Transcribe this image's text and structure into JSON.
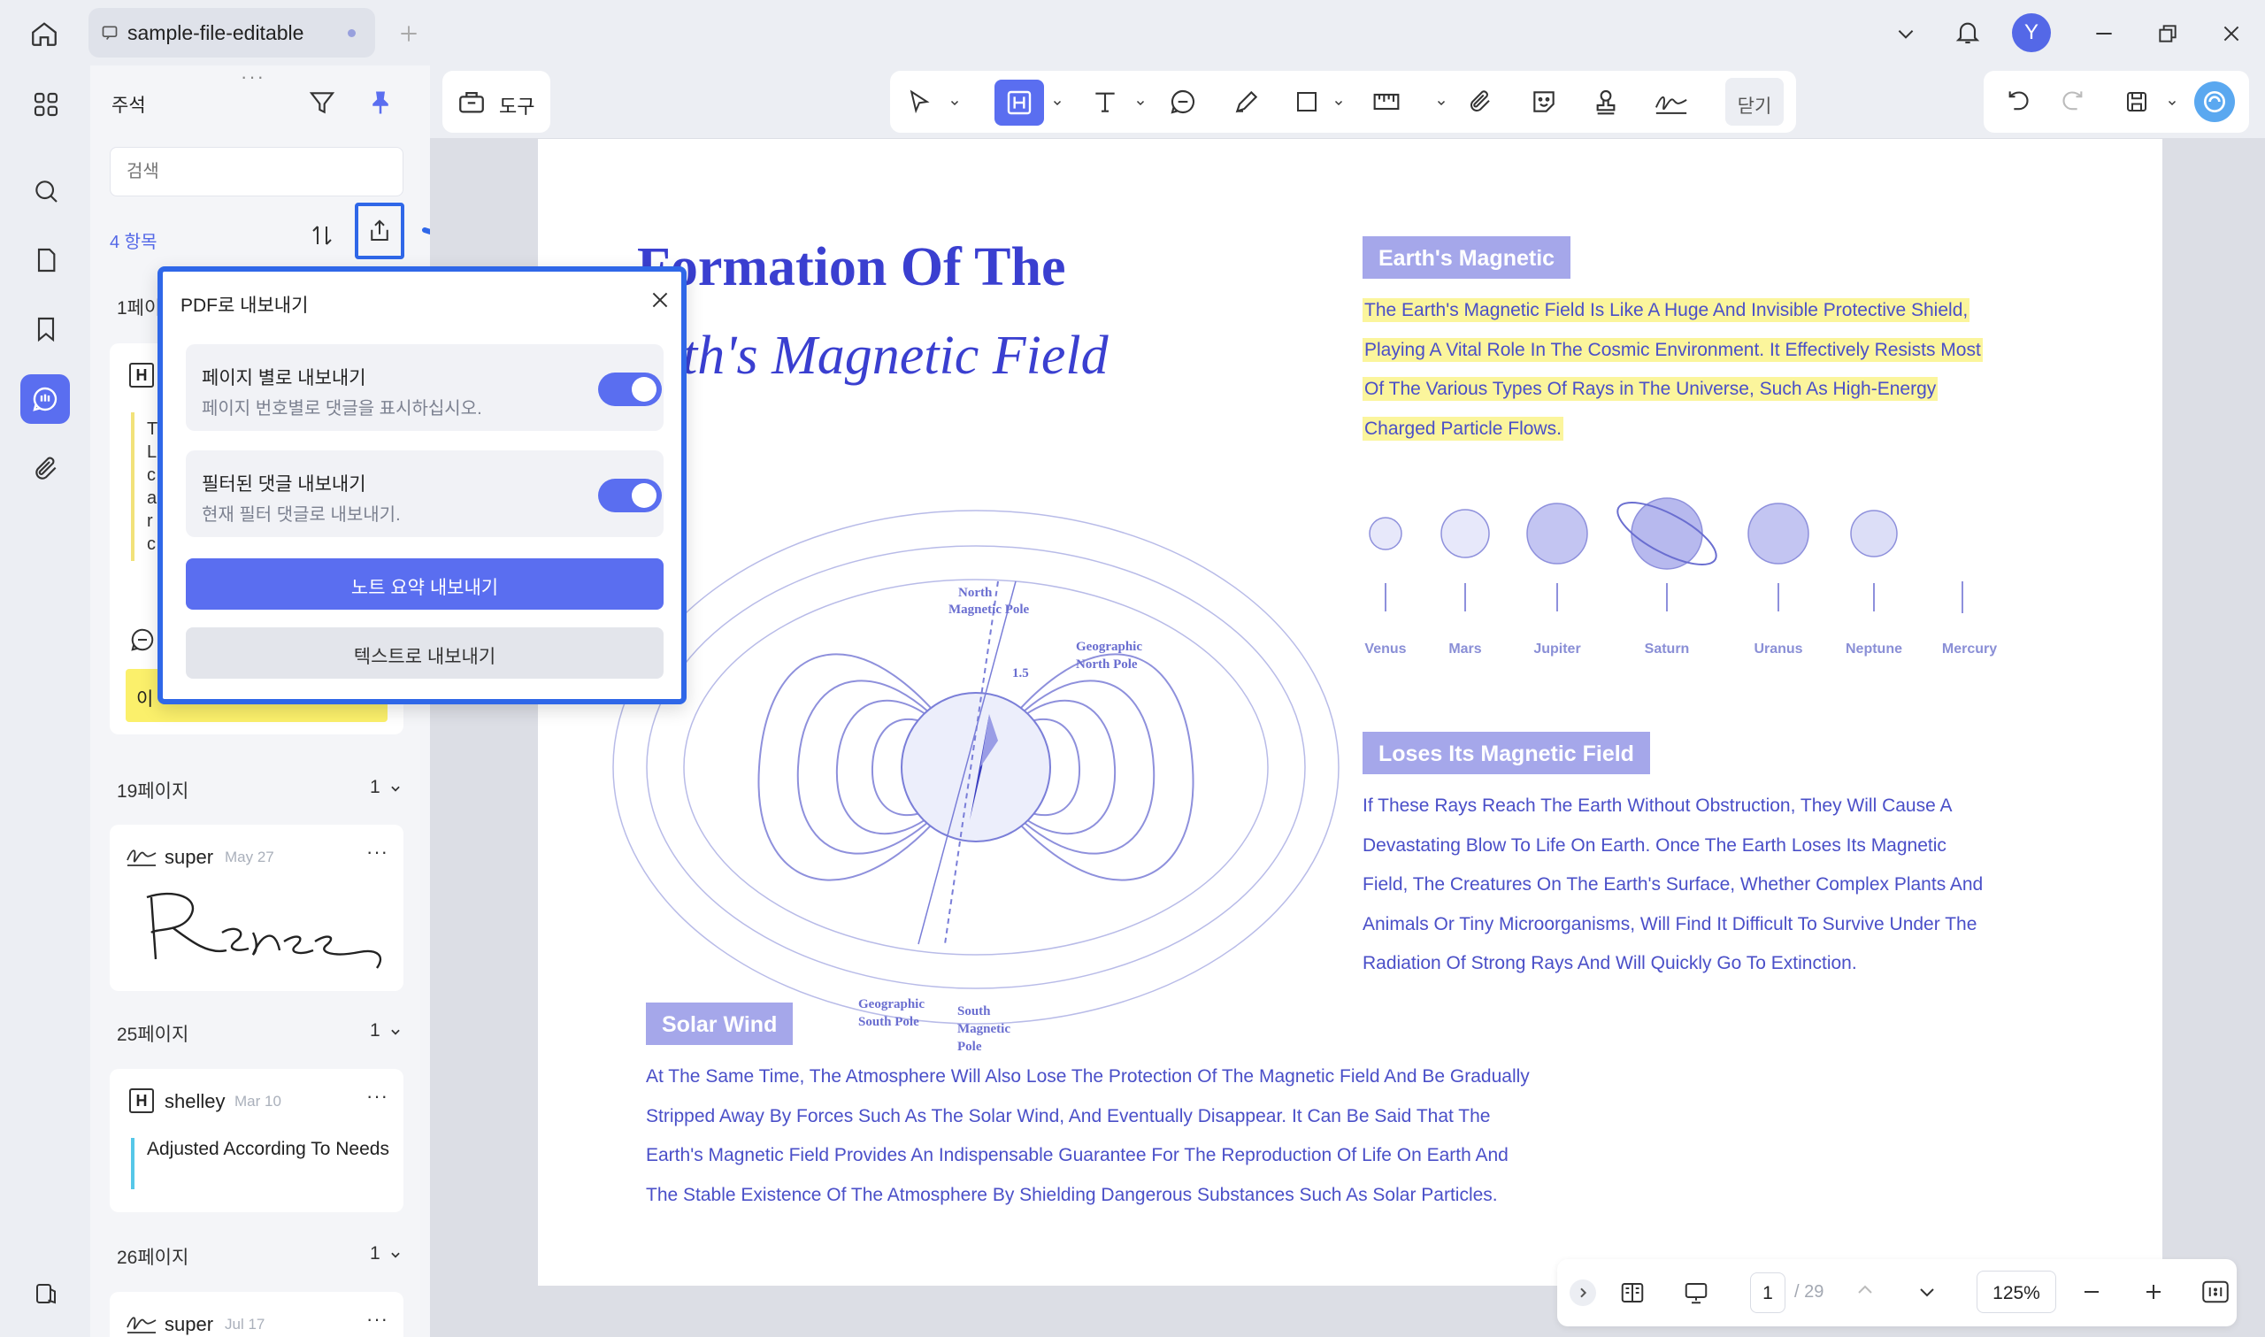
{
  "tab": {
    "title": "sample-file-editable"
  },
  "user": {
    "avatar_letter": "Y"
  },
  "panel": {
    "title": "주석",
    "search_placeholder": "검색",
    "count": "4 항목",
    "sections": [
      {
        "page": "1페이지",
        "count": "1"
      },
      {
        "page": "19페이지",
        "count": "1"
      },
      {
        "page": "25페이지",
        "count": "1"
      },
      {
        "page": "26페이지",
        "count": "1"
      }
    ],
    "partial_section": "1페이",
    "hidden_card_chars": [
      "T",
      "L",
      "c",
      "a",
      "r",
      "c"
    ],
    "hidden_note_text": "이",
    "cards": [
      {
        "user": "super",
        "date": "May 27"
      },
      {
        "user": "shelley",
        "date": "Mar 10",
        "text": "Adjusted According To Needs"
      },
      {
        "user": "super",
        "date": "Jul 17"
      }
    ]
  },
  "toolbar": {
    "tools_label": "도구",
    "close_label": "닫기"
  },
  "dialog": {
    "title": "PDF로 내보내기",
    "option1_title": "페이지 별로 내보내기",
    "option1_desc": "페이지 번호별로 댓글을 표시하십시오.",
    "option2_title": "필터된 댓글 내보내기",
    "option2_desc": "현재 필터 댓글로 내보내기.",
    "primary_button": "노트 요약 내보내기",
    "secondary_button": "텍스트로 내보내기"
  },
  "document": {
    "title_line1": "Formation Of The",
    "title_line2": "Earth's Magnetic Field",
    "diagram": {
      "north_magnetic_pole": "North Magnetic Pole",
      "geographic_north_pole": "Geographic North Pole",
      "geographic_south_pole": "Geographic South Pole",
      "south_magnetic_pole": "South Magnetic Pole",
      "angle": "1.5"
    },
    "section1": {
      "heading": "Earth's Magnetic",
      "lines": [
        "The Earth's Magnetic Field Is Like A Huge And Invisible Protective Shield,",
        "Playing A Vital Role In The Cosmic Environment. It Effectively Resists Most",
        "Of The Various Types Of Rays in The Universe, Such As High-Energy",
        "Charged Particle Flows."
      ]
    },
    "planets": [
      "Venus",
      "Mars",
      "Jupiter",
      "Saturn",
      "Uranus",
      "Neptune",
      "Mercury"
    ],
    "section2": {
      "heading": "Loses Its Magnetic Field",
      "lines": [
        "If These Rays Reach The Earth Without Obstruction, They Will Cause A",
        "Devastating Blow To Life On Earth. Once The Earth Loses Its Magnetic",
        "Field, The Creatures On The Earth's Surface, Whether Complex Plants And",
        "Animals Or Tiny Microorganisms, Will Find It Difficult To Survive Under The",
        "Radiation Of Strong Rays And Will Quickly Go To Extinction."
      ]
    },
    "section3": {
      "heading": "Solar Wind",
      "lines": [
        "At The Same Time, The Atmosphere Will Also Lose The Protection Of The Magnetic Field And Be Gradually",
        "Stripped Away By Forces Such As The Solar Wind, And Eventually Disappear. It Can Be Said That The",
        "Earth's Magnetic Field Provides An Indispensable Guarantee For The Reproduction Of Life On Earth And",
        "The Stable Existence Of The Atmosphere By Shielding Dangerous Substances Such As Solar Particles."
      ]
    }
  },
  "bottombar": {
    "page": "1",
    "total": "/ 29",
    "zoom": "125%"
  },
  "colors": {
    "accent": "#5a6ef0",
    "highlight_border": "#2f67e8",
    "doc_text": "#4a4fc8",
    "tag_bg": "#a5a7ea",
    "highlight": "#fbf59c"
  }
}
